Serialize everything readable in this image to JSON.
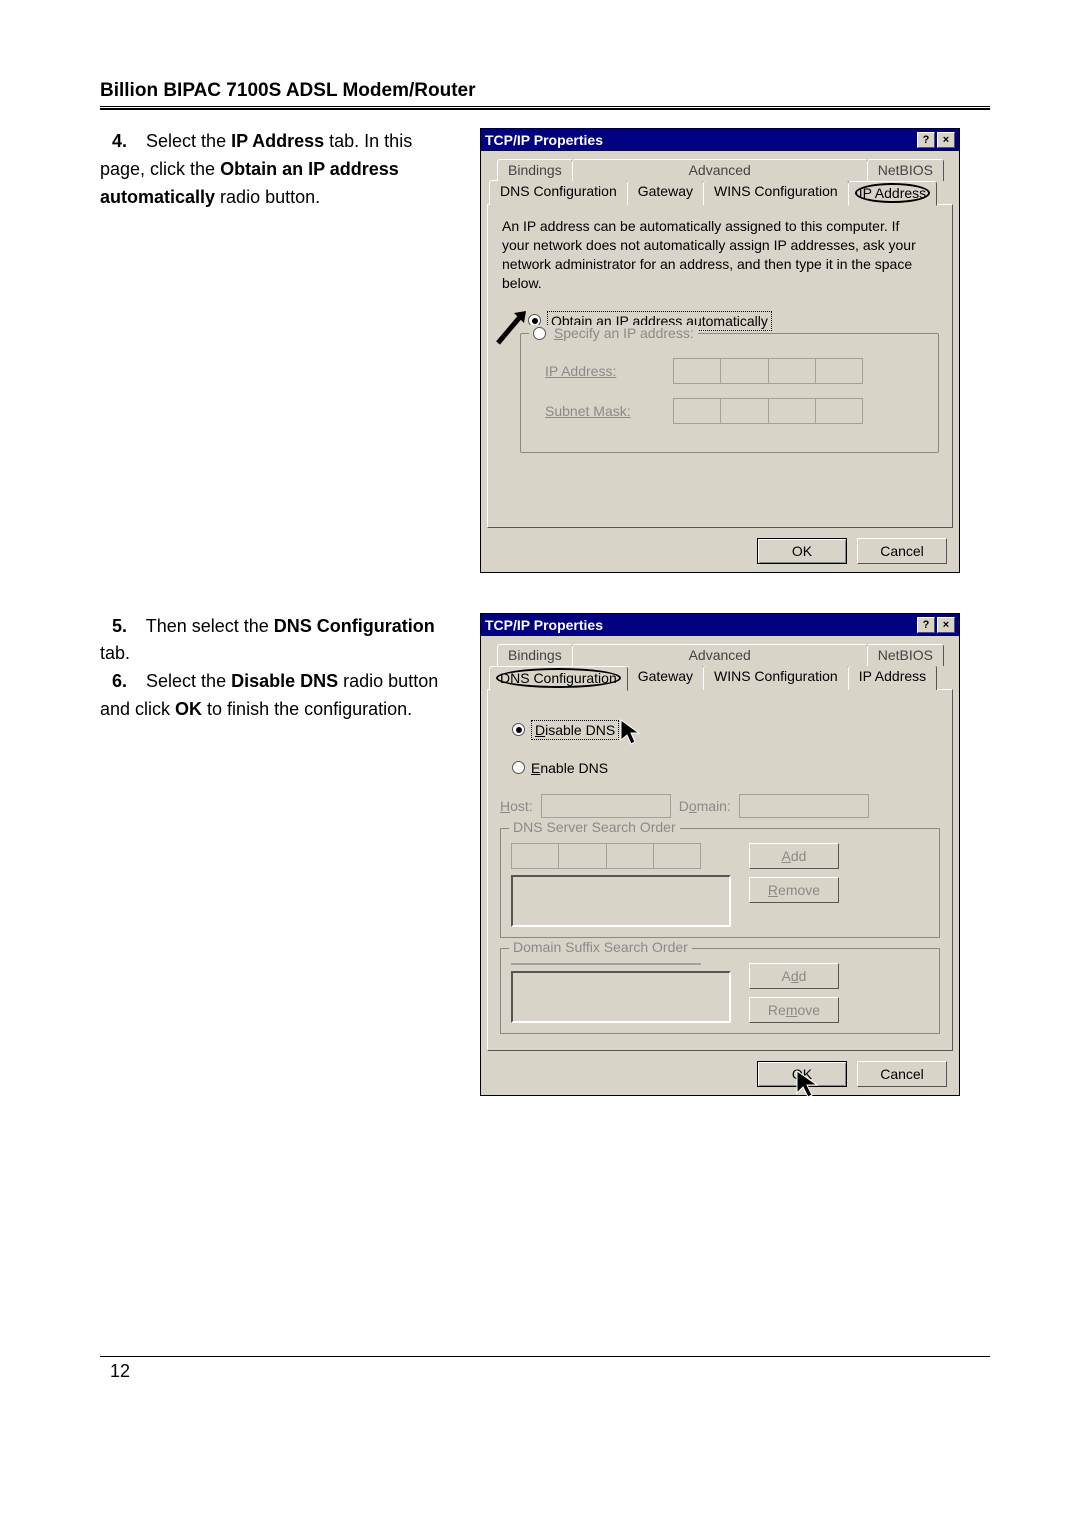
{
  "doc": {
    "header": "Billion BIPAC 7100S ADSL Modem/Router",
    "page_num": "12"
  },
  "sec1": {
    "num": "4.",
    "line1a": "Select the ",
    "line1b": "IP Address",
    "line1c": " tab. In this",
    "line2a": "page, click the ",
    "line2b": "Obtain an IP address",
    "line3a": "automatically",
    "line3b": " radio button."
  },
  "sec2": {
    "num1": "5.",
    "line1a": "Then select the ",
    "line1b": "DNS Configuration",
    "line2": "tab.",
    "num2": "6.",
    "line3a": "Select the ",
    "line3b": "Disable DNS",
    "line3c": " radio button",
    "line4a": "and click ",
    "line4b": "OK",
    "line4c": " to finish the configuration."
  },
  "dlg1": {
    "title": "TCP/IP Properties",
    "help_icon": "?",
    "close_icon": "×",
    "tabs_back": {
      "bindings": "Bindings",
      "advanced": "Advanced",
      "netbios": "NetBIOS"
    },
    "tabs_front": {
      "dnsconf": "DNS Configuration",
      "gateway": "Gateway",
      "winsconf": "WINS Configuration",
      "ipaddr": "IP Address"
    },
    "help_text": "An IP address can be automatically assigned to this computer. If your network does not automatically assign IP addresses, ask your network administrator for an address, and then type it in the space below.",
    "radio_auto": "Obtain an IP address automatically",
    "radio_spec": "Specify an IP address:",
    "field_ip": "IP Address:",
    "field_mask": "Subnet Mask:",
    "ok": "OK",
    "cancel": "Cancel"
  },
  "dlg2": {
    "title": "TCP/IP Properties",
    "tabs_back": {
      "bindings": "Bindings",
      "advanced": "Advanced",
      "netbios": "NetBIOS"
    },
    "tabs_front": {
      "dnsconf": "DNS Configuration",
      "gateway": "Gateway",
      "winsconf": "WINS Configuration",
      "ipaddr": "IP Address"
    },
    "radio_disable": "Disable DNS",
    "radio_enable": "Enable DNS",
    "host": "Host:",
    "domain": "Domain:",
    "group1": "DNS Server Search Order",
    "group2": "Domain Suffix Search Order",
    "add": "Add",
    "remove": "Remove",
    "ok": "OK",
    "cancel": "Cancel"
  }
}
